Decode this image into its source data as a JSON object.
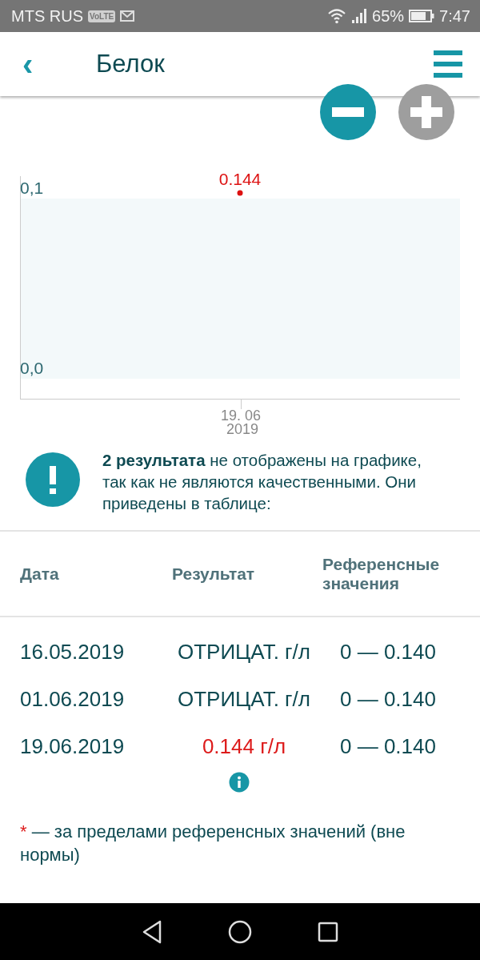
{
  "status_bar": {
    "carrier": "MTS RUS",
    "volte": "VoLTE",
    "battery_percent": "65%",
    "time": "7:47"
  },
  "header": {
    "back": "‹",
    "title": "Белок"
  },
  "zoom": {
    "minus_disabled": false,
    "plus_disabled": true
  },
  "chart": {
    "y_labels": [
      "0,1",
      "0,0"
    ],
    "point_label": "0.144",
    "x_label_day": "19. 06",
    "x_label_year": "2019"
  },
  "notice": {
    "text": "**2 результата** не отображены на графике, так как не являются качественными. Они приведены в таблице:"
  },
  "table": {
    "columns": [
      "Дата",
      "Результат",
      "Референсные значения"
    ],
    "rows": [
      {
        "date": "16.05.2019",
        "result": "ОТРИЦАТ. г/л",
        "reference": "0 — 0.140",
        "out_of_range": false,
        "info": false
      },
      {
        "date": "01.06.2019",
        "result": "ОТРИЦАТ. г/л",
        "reference": "0 — 0.140",
        "out_of_range": false,
        "info": false
      },
      {
        "date": "19.06.2019",
        "result": "0.144 г/л",
        "reference": "0 — 0.140",
        "out_of_range": true,
        "info": true
      }
    ]
  },
  "footnote": {
    "marker": "*",
    "text": "— за пределами референсных значений (вне нормы)"
  }
}
